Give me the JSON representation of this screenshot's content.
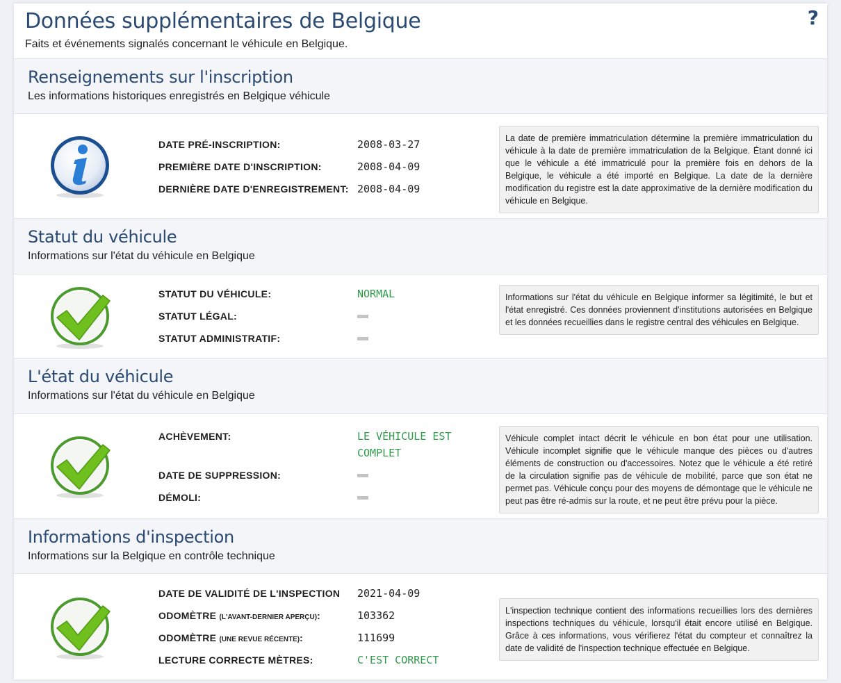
{
  "header": {
    "title": "Données supplémentaires de Belgique",
    "subtitle": "Faits et événements signalés concernant le véhicule en Belgique.",
    "help_label": "?"
  },
  "sections": {
    "registration": {
      "title": "Renseignements sur l'inscription",
      "subtitle": "Les informations historiques enregistrés en Belgique véhicule",
      "icon": "info-icon",
      "rows": [
        {
          "label": "Date pré-inscription:",
          "value": "2008-03-27"
        },
        {
          "label": "Première date d'inscription:",
          "value": "2008-04-09"
        },
        {
          "label": "Dernière date d'enregistrement:",
          "value": "2008-04-09"
        }
      ],
      "note": "La date de première immatriculation détermine la première immatriculation du véhicule à la date de première immatriculation de la Belgique. Étant donné ici que le véhicule a été immatriculé pour la première fois en dehors de la Belgique, le véhicule a été importé en Belgique. La date de la dernière modification du registre est la date approximative de la dernière modification du véhicule en Belgique."
    },
    "status": {
      "title": "Statut du véhicule",
      "subtitle": "Informations sur l'état du véhicule en Belgique",
      "icon": "checkmark-icon",
      "rows": [
        {
          "label": "Statut du véhicule:",
          "value": "NORMAL"
        },
        {
          "label": "Statut légal:",
          "value": ""
        },
        {
          "label": "Statut administratif:",
          "value": ""
        }
      ],
      "note": "Informations sur l'état du véhicule en Belgique informer sa légitimité, le but et l'état enregistré. Ces données proviennent d'institutions autorisées en Belgique et les données recueillies dans le registre central des véhicules en Belgique."
    },
    "condition": {
      "title": "L'état du véhicule",
      "subtitle": "Informations sur l'état du véhicule en Belgique",
      "icon": "checkmark-icon",
      "rows": [
        {
          "label": "Achèvement:",
          "value": "LE VÉHICULE EST COMPLET"
        },
        {
          "label": "Date de suppression:",
          "value": ""
        },
        {
          "label": "Démoli:",
          "value": ""
        }
      ],
      "note": "Véhicule complet intact décrit le véhicule en bon état pour une utilisation. Véhicule incomplet signifie que le véhicule manque des pièces ou d'autres éléments de construction ou d'accessoires. Notez que le véhicule a été retiré de la circulation signifie pas de véhicule de mobilité, parce que son état ne permet pas. Véhicule conçu pour des moyens de démontage que le véhicule ne peut pas être ré-admis sur la route, et ne peut être prévu pour la pièce."
    },
    "inspection": {
      "title": "Informations d'inspection",
      "subtitle": "Informations sur la Belgique en contrôle technique",
      "icon": "checkmark-icon",
      "rows": [
        {
          "label": "Date de validité de l'inspection",
          "value": "2021-04-09"
        },
        {
          "label": "Odomètre",
          "label_small": "(l'avant-dernier aperçu)",
          "label_suffix": ":",
          "value": "103362"
        },
        {
          "label": "Odomètre",
          "label_small": "(une revue récente)",
          "label_suffix": ":",
          "value": "111699"
        },
        {
          "label": "Lecture correcte mètres:",
          "value": "C'EST CORRECT"
        }
      ],
      "note": "L'inspection technique contient des informations recueillies lors des dernières inspections techniques du véhicule, lorsqu'il était encore utilisé en Belgique. Grâce à ces informations, vous vérifierez l'état du compteur et connaîtrez la date de validité de l'inspection technique effectuée en Belgique."
    }
  },
  "colors": {
    "title_blue": "#2a4a73",
    "ok_green": "#2e9b4a",
    "check_green": "#6fbf1f",
    "info_blue": "#1f5a9e"
  }
}
